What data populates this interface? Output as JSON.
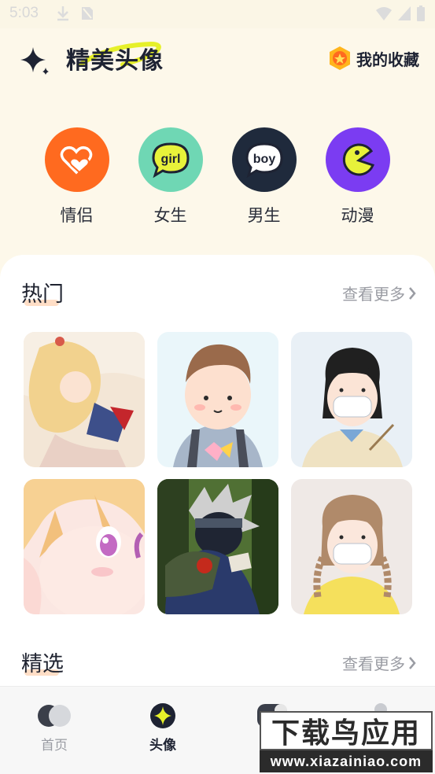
{
  "status_bar": {
    "time": "5:03"
  },
  "header": {
    "title": "精美头像",
    "favorites_label": "我的收藏",
    "favorites_icon": "badge-star-icon"
  },
  "categories": [
    {
      "label": "情侣",
      "icon": "hearts-icon",
      "color": "#ff6a1f"
    },
    {
      "label": "女生",
      "icon": "girl-bubble-icon",
      "color": "#6fd7b4"
    },
    {
      "label": "男生",
      "icon": "boy-bubble-icon",
      "color": "#1f2a3c"
    },
    {
      "label": "动漫",
      "icon": "pacman-icon",
      "color": "#7b3cf2"
    }
  ],
  "hot": {
    "title": "热门",
    "more_label": "查看更多"
  },
  "featured": {
    "title": "精选",
    "more_label": "查看更多"
  },
  "bottom_nav": [
    {
      "label": "首页",
      "active": false
    },
    {
      "label": "头像",
      "active": true
    },
    {
      "label": "",
      "active": false
    },
    {
      "label": "",
      "active": false
    }
  ],
  "watermark": {
    "top": "下载鸟应用",
    "bottom": "www.xiazainiao.com"
  },
  "colors": {
    "background": "#fdf8ea",
    "accent_yellow": "#e6f02a",
    "text_dark": "#1e2333",
    "muted": "#9a9ca3"
  }
}
